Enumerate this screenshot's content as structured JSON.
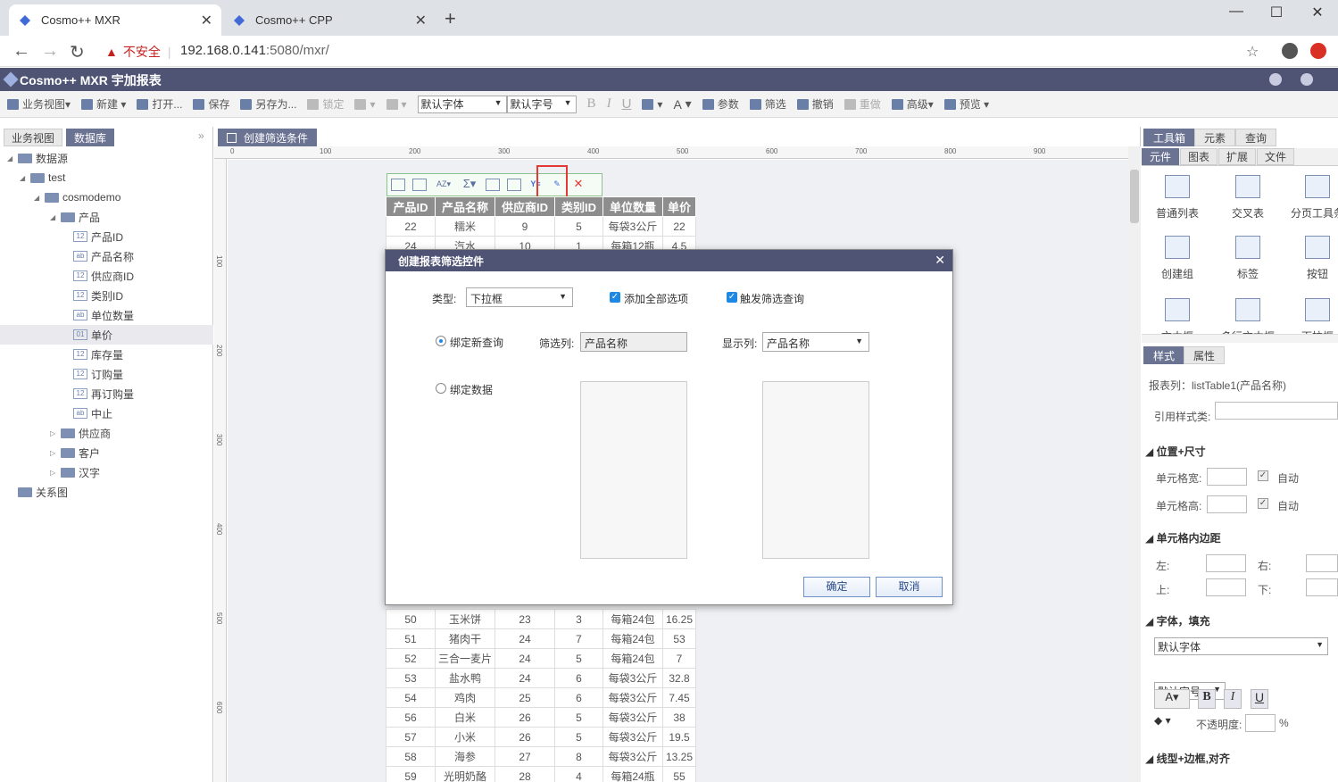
{
  "browser": {
    "tabs": [
      {
        "title": "Cosmo++ MXR",
        "active": true
      },
      {
        "title": "Cosmo++ CPP",
        "active": false
      }
    ],
    "insecure_label": "不安全",
    "url_host": "192.168.0.141",
    "url_rest": ":5080/mxr/"
  },
  "app": {
    "title": "Cosmo++ MXR 宇加报表",
    "toolbar": {
      "business_view": "业务视图",
      "new": "新建",
      "open": "打开...",
      "save": "保存",
      "save_as": "另存为...",
      "lock": "锁定",
      "font": "默认字体",
      "font_size": "默认字号",
      "bold": "B",
      "italic": "I",
      "underline": "U",
      "font_color": "A",
      "params": "参数",
      "filter": "筛选",
      "undo": "撤销",
      "redo": "重做",
      "advanced": "高级",
      "preview": "预览"
    }
  },
  "left_panel": {
    "tabs": [
      "业务视图",
      "数据库"
    ],
    "tree": [
      {
        "label": "数据源",
        "level": 0,
        "type": "folder"
      },
      {
        "label": "test",
        "level": 1,
        "type": "db"
      },
      {
        "label": "cosmodemo",
        "level": 2,
        "type": "db"
      },
      {
        "label": "产品",
        "level": 3,
        "type": "table"
      },
      {
        "label": "产品ID",
        "level": 4,
        "type": "field",
        "tag": "12"
      },
      {
        "label": "产品名称",
        "level": 4,
        "type": "field",
        "tag": "ab"
      },
      {
        "label": "供应商ID",
        "level": 4,
        "type": "field",
        "tag": "12"
      },
      {
        "label": "类别ID",
        "level": 4,
        "type": "field",
        "tag": "12"
      },
      {
        "label": "单位数量",
        "level": 4,
        "type": "field",
        "tag": "ab"
      },
      {
        "label": "单价",
        "level": 4,
        "type": "field",
        "tag": "01",
        "selected": true
      },
      {
        "label": "库存量",
        "level": 4,
        "type": "field",
        "tag": "12"
      },
      {
        "label": "订购量",
        "level": 4,
        "type": "field",
        "tag": "12"
      },
      {
        "label": "再订购量",
        "level": 4,
        "type": "field",
        "tag": "12"
      },
      {
        "label": "中止",
        "level": 4,
        "type": "field",
        "tag": "ab"
      },
      {
        "label": "供应商",
        "level": 3,
        "type": "table"
      },
      {
        "label": "客户",
        "level": 3,
        "type": "table"
      },
      {
        "label": "汉字",
        "level": 3,
        "type": "table"
      },
      {
        "label": "关系图",
        "level": 0,
        "type": "rel"
      }
    ]
  },
  "center": {
    "doc_tab": "创建筛选条件",
    "ruler_h": [
      "0",
      "100",
      "200",
      "300",
      "400",
      "500",
      "600",
      "700",
      "800",
      "900"
    ],
    "ruler_v": [
      "100",
      "200",
      "300",
      "400",
      "500",
      "600"
    ],
    "table_headers": [
      "产品ID",
      "产品名称",
      "供应商ID",
      "类别ID",
      "单位数量",
      "单价"
    ],
    "rows_top": [
      [
        "22",
        "糯米",
        "9",
        "5",
        "每袋3公斤",
        "22"
      ],
      [
        "24",
        "汽水",
        "10",
        "1",
        "每箱12瓶",
        "4.5"
      ]
    ],
    "rows_bottom": [
      [
        "50",
        "玉米饼",
        "23",
        "3",
        "每箱24包",
        "16.25"
      ],
      [
        "51",
        "猪肉干",
        "24",
        "7",
        "每箱24包",
        "53"
      ],
      [
        "52",
        "三合一麦片",
        "24",
        "5",
        "每箱24包",
        "7"
      ],
      [
        "53",
        "盐水鸭",
        "24",
        "6",
        "每袋3公斤",
        "32.8"
      ],
      [
        "54",
        "鸡肉",
        "25",
        "6",
        "每袋3公斤",
        "7.45"
      ],
      [
        "56",
        "白米",
        "26",
        "5",
        "每袋3公斤",
        "38"
      ],
      [
        "57",
        "小米",
        "26",
        "5",
        "每袋3公斤",
        "19.5"
      ],
      [
        "58",
        "海参",
        "27",
        "8",
        "每袋3公斤",
        "13.25"
      ],
      [
        "59",
        "光明奶酪",
        "28",
        "4",
        "每箱24瓶",
        "55"
      ]
    ]
  },
  "right_panel": {
    "top_tabs": [
      "工具箱",
      "元素",
      "查询"
    ],
    "sub_tabs": [
      "元件",
      "图表",
      "扩展",
      "文件"
    ],
    "tools": [
      {
        "label": "普通列表",
        "icon": "list-table-icon"
      },
      {
        "label": "交叉表",
        "icon": "cross-table-icon"
      },
      {
        "label": "分页工具条",
        "icon": "pager-icon"
      },
      {
        "label": "创建组",
        "icon": "group-icon"
      },
      {
        "label": "标签",
        "icon": "label-icon"
      },
      {
        "label": "按钮",
        "icon": "button-icon"
      },
      {
        "label": "文本框",
        "icon": "textbox-icon"
      },
      {
        "label": "多行文本框",
        "icon": "textarea-icon"
      },
      {
        "label": "下拉框",
        "icon": "dropdown-icon"
      }
    ],
    "prop_tabs": [
      "样式",
      "属性"
    ],
    "report_column": "报表列：listTable1(产品名称)",
    "style_class_label": "引用样式类:",
    "sec_position": "位置+尺寸",
    "cell_width": "单元格宽:",
    "cell_height": "单元格高:",
    "auto": "自动",
    "sec_padding": "单元格内边距",
    "left": "左:",
    "right": "右:",
    "top": "上:",
    "bottom": "下:",
    "sec_font": "字体，填充",
    "font": "默认字体",
    "font_size": "默认字号",
    "opacity": "不透明度:",
    "percent": "%",
    "sec_border": "线型+边框,对齐"
  },
  "dialog": {
    "title": "创建报表筛选控件",
    "type_label": "类型:",
    "type_value": "下拉框",
    "add_all_label": "添加全部选项",
    "trigger_label": "触发筛选查询",
    "bind_query_label": "绑定新查询",
    "filter_col_label": "筛选列:",
    "filter_col_value": "产品名称",
    "display_col_label": "显示列:",
    "display_col_value": "产品名称",
    "bind_data_label": "绑定数据",
    "ok": "确定",
    "cancel": "取消"
  }
}
